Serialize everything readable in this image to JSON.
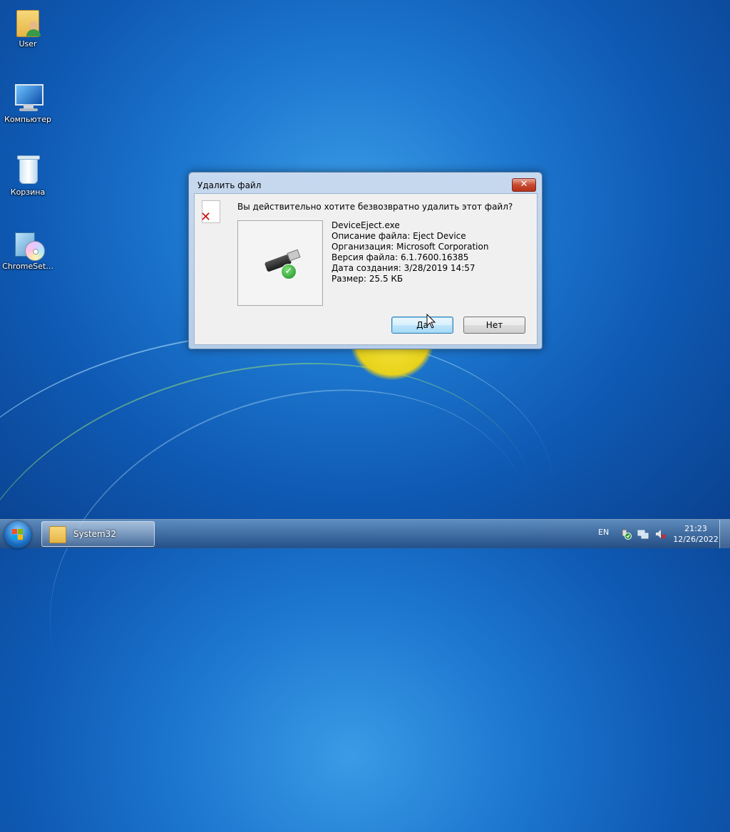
{
  "desktop": {
    "icons": [
      {
        "label": "User",
        "icon": "user-folder-icon"
      },
      {
        "label": "Компьютер",
        "icon": "computer-icon"
      },
      {
        "label": "Корзина",
        "icon": "recycle-bin-icon"
      },
      {
        "label": "ChromeSet...",
        "icon": "setup-installer-icon"
      }
    ]
  },
  "dialog": {
    "title": "Удалить файл",
    "close_symbol": "✕",
    "question": "Вы действительно хотите безвозвратно удалить этот файл?",
    "file": {
      "name": "DeviceEject.exe",
      "description": "Описание файла: Eject Device",
      "organization": "Организация: Microsoft Corporation",
      "version": "Версия файла: 6.1.7600.16385",
      "created": "Дата создания: 3/28/2019 14:57",
      "size": "Размер: 25.5 КБ"
    },
    "yes_label": "Да",
    "no_label": "Нет"
  },
  "taskbar": {
    "open_window_label": "System32",
    "language": "EN",
    "time": "21:23",
    "date": "12/26/2022"
  },
  "colors": {
    "desktop_accent": "#1e79d0",
    "close_button": "#c8482f",
    "default_button_border": "#3c7fb1"
  }
}
